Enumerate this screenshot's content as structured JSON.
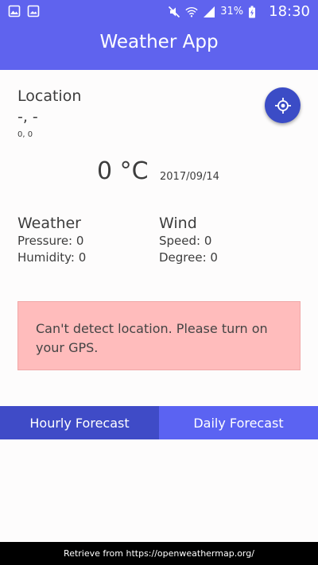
{
  "status_bar": {
    "battery": "31%",
    "time": "18:30",
    "icons": [
      "photo-icon",
      "image-icon",
      "mute-icon",
      "wifi-icon",
      "signal-icon",
      "battery-charging-icon"
    ]
  },
  "app_bar": {
    "title": "Weather App"
  },
  "location": {
    "label": "Location",
    "name": "-, -",
    "coords": "0, 0",
    "locate_icon": "gps-locate-icon"
  },
  "current": {
    "temperature": "0 °C",
    "date": "2017/09/14"
  },
  "weather": {
    "heading": "Weather",
    "pressure": "Pressure: 0",
    "humidity": "Humidity: 0"
  },
  "wind": {
    "heading": "Wind",
    "speed": "Speed: 0",
    "degree": "Degree: 0"
  },
  "alert": {
    "message": "Can't detect location. Please turn on your GPS."
  },
  "tabs": [
    {
      "label": "Hourly Forecast"
    },
    {
      "label": "Daily Forecast"
    }
  ],
  "footer": {
    "text": "Retrieve from https://openweathermap.org/"
  },
  "colors": {
    "primary": "#5f63ee",
    "tab_active": "#3f4bc7",
    "tab_inactive": "#5b63f2",
    "locate_button": "#3b4cc6",
    "alert_background": "#ffbcbc"
  }
}
